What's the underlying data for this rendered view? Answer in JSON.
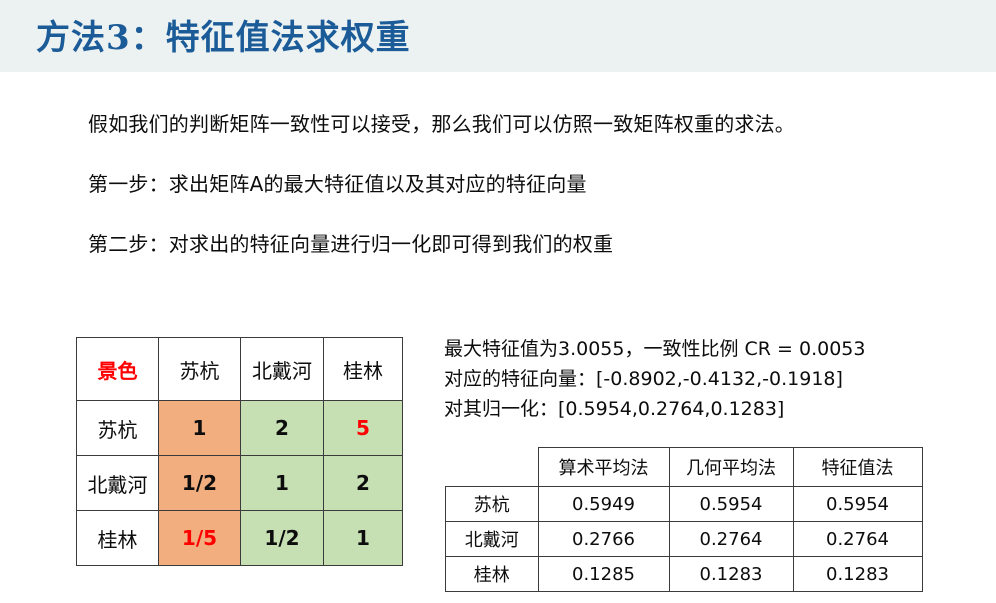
{
  "header": {
    "title": "方法3：特征值法求权重",
    "band_color": "#ecf1f2",
    "title_color": "#1a5b98"
  },
  "body": {
    "intro": "假如我们的判断矩阵一致性可以接受，那么我们可以仿照一致矩阵权重的求法。",
    "step_one": "第一步：求出矩阵A的最大特征值以及其对应的特征向量",
    "step_two": "第二步：对求出的特征向量进行归一化即可得到我们的权重"
  },
  "matrix_table": {
    "corner_label": "景色",
    "columns": [
      "苏杭",
      "北戴河",
      "桂林"
    ],
    "rows": [
      {
        "label": "苏杭",
        "cells": [
          "1",
          "2",
          "5"
        ]
      },
      {
        "label": "北戴河",
        "cells": [
          "1/2",
          "1",
          "2"
        ]
      },
      {
        "label": "桂林",
        "cells": [
          "1/5",
          "1/2",
          "1"
        ]
      }
    ],
    "colors": {
      "orange": "#f2ae7e",
      "green": "#c6e0b4",
      "highlight_text": "#ff0000"
    }
  },
  "results_text": {
    "eigenvalue": "最大特征值为3.0055，一致性比例 CR = 0.0053",
    "eigenvector": "对应的特征向量：[-0.8902,-0.4132,-0.1918]",
    "normalized": "对其归一化：[0.5954,0.2764,0.1283]"
  },
  "results_table": {
    "corner": "",
    "columns": [
      "算术平均法",
      "几何平均法",
      "特征值法"
    ],
    "rows": [
      {
        "label": "苏杭",
        "values": [
          "0.5949",
          "0.5954",
          "0.5954"
        ]
      },
      {
        "label": "北戴河",
        "values": [
          "0.2766",
          "0.2764",
          "0.2764"
        ]
      },
      {
        "label": "桂林",
        "values": [
          "0.1285",
          "0.1283",
          "0.1283"
        ]
      }
    ]
  },
  "chart_data": {
    "type": "table",
    "title": "方法3：特征值法求权重",
    "judgement_matrix": {
      "criteria": [
        "苏杭",
        "北戴河",
        "桂林"
      ],
      "values": [
        [
          1,
          2,
          5
        ],
        [
          0.5,
          1,
          2
        ],
        [
          0.2,
          0.5,
          1
        ]
      ],
      "display": [
        [
          "1",
          "2",
          "5"
        ],
        [
          "1/2",
          "1",
          "2"
        ],
        [
          "1/5",
          "1/2",
          "1"
        ]
      ]
    },
    "max_eigenvalue": 3.0055,
    "CR": 0.0053,
    "eigenvector": [
      -0.8902,
      -0.4132,
      -0.1918
    ],
    "normalized_eigenvector": [
      0.5954,
      0.2764,
      0.1283
    ],
    "categories": [
      "苏杭",
      "北戴河",
      "桂林"
    ],
    "series": [
      {
        "name": "算术平均法",
        "values": [
          0.5949,
          0.2766,
          0.1285
        ]
      },
      {
        "name": "几何平均法",
        "values": [
          0.5954,
          0.2764,
          0.1283
        ]
      },
      {
        "name": "特征值法",
        "values": [
          0.5954,
          0.2764,
          0.1283
        ]
      }
    ]
  }
}
